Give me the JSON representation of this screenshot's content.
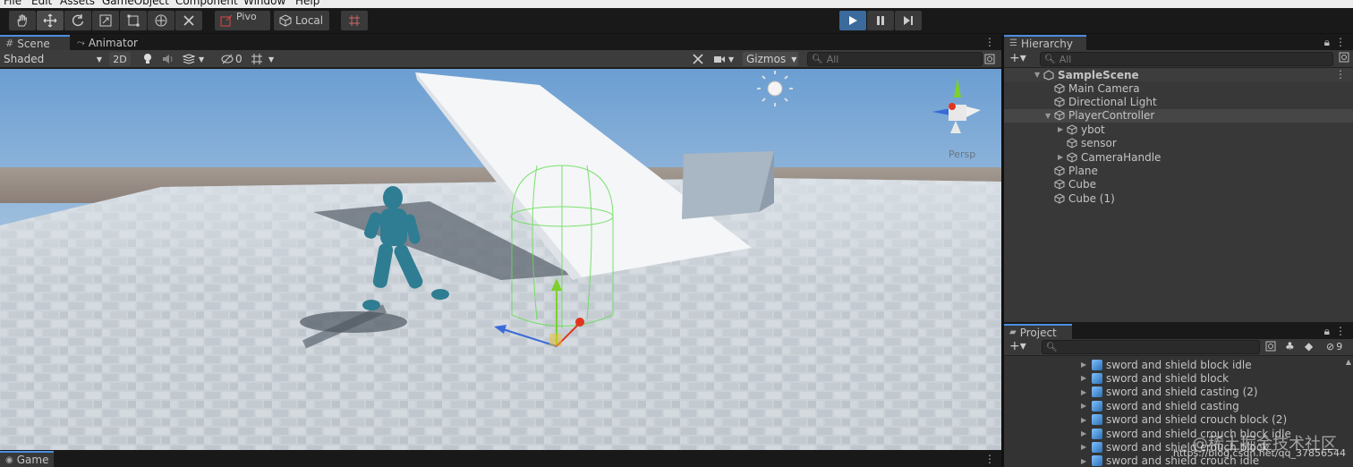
{
  "menu": [
    "File",
    "Edit",
    "Assets",
    "GameObject",
    "Component",
    "Window",
    "Help"
  ],
  "toolbar": {
    "tools": [
      "hand-tool",
      "move-tool",
      "rotate-tool",
      "scale-tool",
      "rect-tool",
      "transform-tool",
      "custom-tool"
    ],
    "pivot_label": "Pivo",
    "space_label": "Local"
  },
  "scene_panel": {
    "tab_scene": "Scene",
    "tab_animator": "Animator",
    "shading_mode": "Shaded",
    "mode_2d": "2D",
    "hidden_count": "0",
    "gizmos_label": "Gizmos",
    "search_placeholder": "All",
    "persp_label": "Persp"
  },
  "game_tab": "Game",
  "hierarchy": {
    "title": "Hierarchy",
    "search_placeholder": "All",
    "scene_name": "SampleScene",
    "items": [
      {
        "label": "Main Camera",
        "depth": 1,
        "expandable": false
      },
      {
        "label": "Directional Light",
        "depth": 1,
        "expandable": false
      },
      {
        "label": "PlayerController",
        "depth": 1,
        "expandable": true,
        "expanded": true,
        "selected": true
      },
      {
        "label": "ybot",
        "depth": 2,
        "expandable": true
      },
      {
        "label": "sensor",
        "depth": 2,
        "expandable": false
      },
      {
        "label": "CameraHandle",
        "depth": 2,
        "expandable": true
      },
      {
        "label": "Plane",
        "depth": 1,
        "expandable": false
      },
      {
        "label": "Cube",
        "depth": 1,
        "expandable": false
      },
      {
        "label": "Cube (1)",
        "depth": 1,
        "expandable": false
      }
    ]
  },
  "project": {
    "title": "Project",
    "hidden_count": "9",
    "items": [
      "sword and shield block idle",
      "sword and shield block",
      "sword and shield casting (2)",
      "sword and shield casting",
      "sword and shield crouch block (2)",
      "sword and shield crouch block idle",
      "sword and shield crouch block",
      "sword and shield crouch idle"
    ]
  },
  "watermark": {
    "line1": "@稀土掘金技术社区",
    "line2": "https://blog.csdn.net/qq_37856544"
  },
  "colors": {
    "accent": "#4d8de0",
    "play_button": "#3b6a9c",
    "panel": "#383838",
    "collider": "#66dd55",
    "character": "#2f7d92"
  }
}
